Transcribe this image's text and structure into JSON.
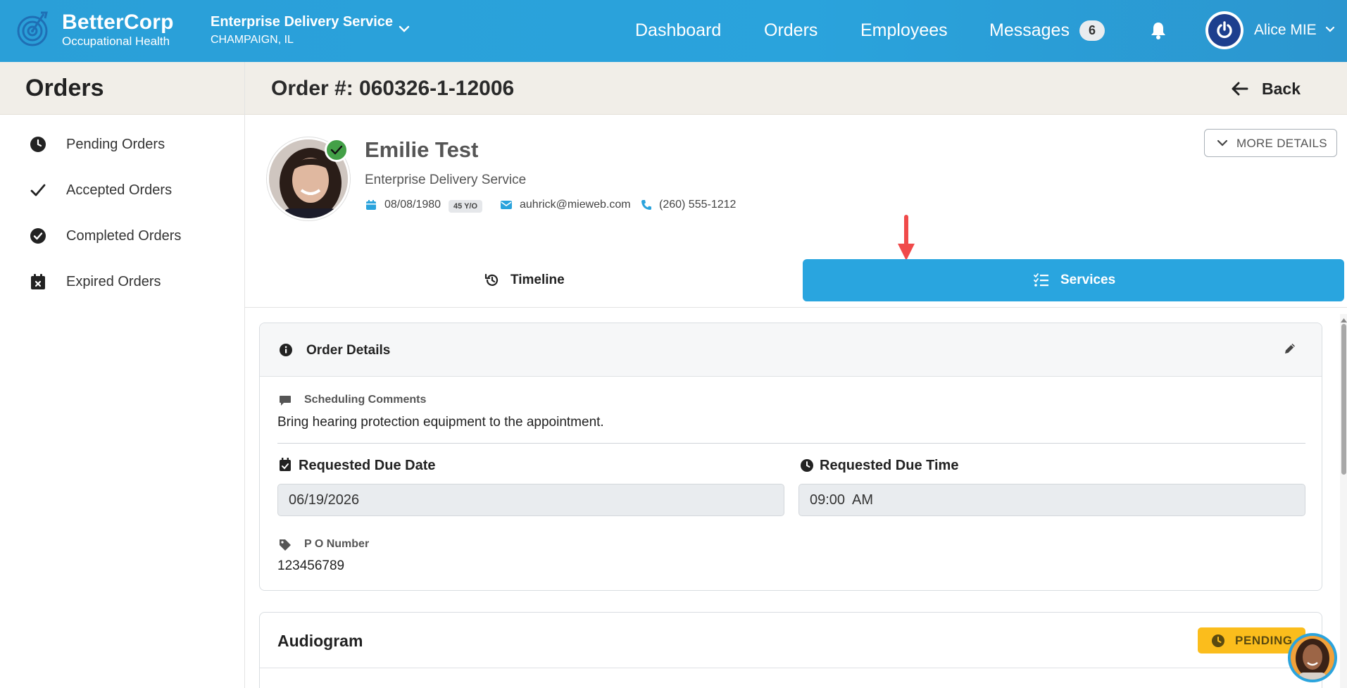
{
  "header": {
    "brand_name": "BetterCorp",
    "brand_sub": "Occupational Health",
    "company_name": "Enterprise Delivery Service",
    "company_location": "CHAMPAIGN, IL",
    "nav": [
      "Dashboard",
      "Orders",
      "Employees",
      "Messages"
    ],
    "messages_count": "6",
    "user_name": "Alice MIE",
    "accent": "#2aa3dc"
  },
  "sidebar": {
    "title": "Orders",
    "items": [
      {
        "label": "Pending Orders",
        "icon": "clock-icon"
      },
      {
        "label": "Accepted Orders",
        "icon": "checkmark-icon"
      },
      {
        "label": "Completed Orders",
        "icon": "check-circle-icon"
      },
      {
        "label": "Expired Orders",
        "icon": "calendar-x-icon"
      }
    ]
  },
  "order": {
    "title": "Order #: 060326-1-12006",
    "back_label": "Back",
    "more_details_label": "MORE DETAILS"
  },
  "patient": {
    "name": "Emilie Test",
    "company": "Enterprise Delivery Service",
    "dob": "08/08/1980",
    "age": "45 Y/O",
    "email": "auhrick@mieweb.com",
    "phone": "(260) 555-1212"
  },
  "tabs": {
    "timeline_label": "Timeline",
    "services_label": "Services",
    "active": "Services"
  },
  "order_details": {
    "title": "Order Details",
    "scheduling_label": "Scheduling Comments",
    "scheduling_value": "Bring hearing protection equipment to the appointment.",
    "due_date_label": "Requested Due Date",
    "due_date_value": "06/19/2026",
    "due_time_label": "Requested Due Time",
    "due_time_value": "09:00  AM",
    "po_label": "P O Number",
    "po_value": "123456789"
  },
  "audiogram": {
    "title": "Audiogram",
    "status": "PENDING",
    "status_color": "#fbbd1c"
  }
}
